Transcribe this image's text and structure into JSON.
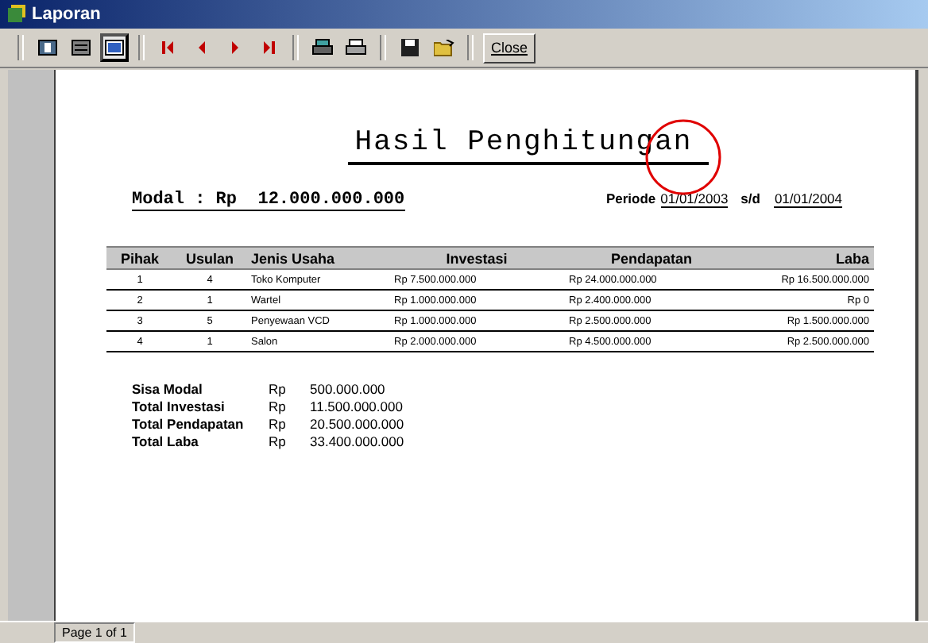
{
  "window": {
    "title": "Laporan"
  },
  "toolbar": {
    "close_button": "Close"
  },
  "report": {
    "title": "Hasil Penghitungan",
    "modal": "Modal : Rp  12.000.000.000",
    "period_label": "Periode",
    "period_from": "01/01/2003",
    "period_sep": "s/d",
    "period_to": "01/01/2004",
    "table": {
      "columns": [
        "Pihak",
        "Usulan",
        "Jenis Usaha",
        "Investasi",
        "Pendapatan",
        "Laba"
      ],
      "rows": [
        [
          "1",
          "4",
          "Toko Komputer",
          "Rp 7.500.000.000",
          "Rp 24.000.000.000",
          "Rp 16.500.000.000"
        ],
        [
          "2",
          "1",
          "Wartel",
          "Rp 1.000.000.000",
          "Rp 2.400.000.000",
          "Rp 0"
        ],
        [
          "3",
          "5",
          "Penyewaan VCD",
          "Rp 1.000.000.000",
          "Rp 2.500.000.000",
          "Rp 1.500.000.000"
        ],
        [
          "4",
          "1",
          "Salon",
          "Rp 2.000.000.000",
          "Rp 4.500.000.000",
          "Rp 2.500.000.000"
        ]
      ]
    },
    "summary": [
      {
        "label": "Sisa Modal",
        "currency": "Rp",
        "value": "500.000.000"
      },
      {
        "label": "Total Investasi",
        "currency": "Rp",
        "value": "11.500.000.000"
      },
      {
        "label": "Total Pendapatan",
        "currency": "Rp",
        "value": "20.500.000.000"
      },
      {
        "label": "Total Laba",
        "currency": "Rp",
        "value": "33.400.000.000"
      }
    ]
  },
  "status_bar": {
    "page": "Page 1 of 1"
  }
}
